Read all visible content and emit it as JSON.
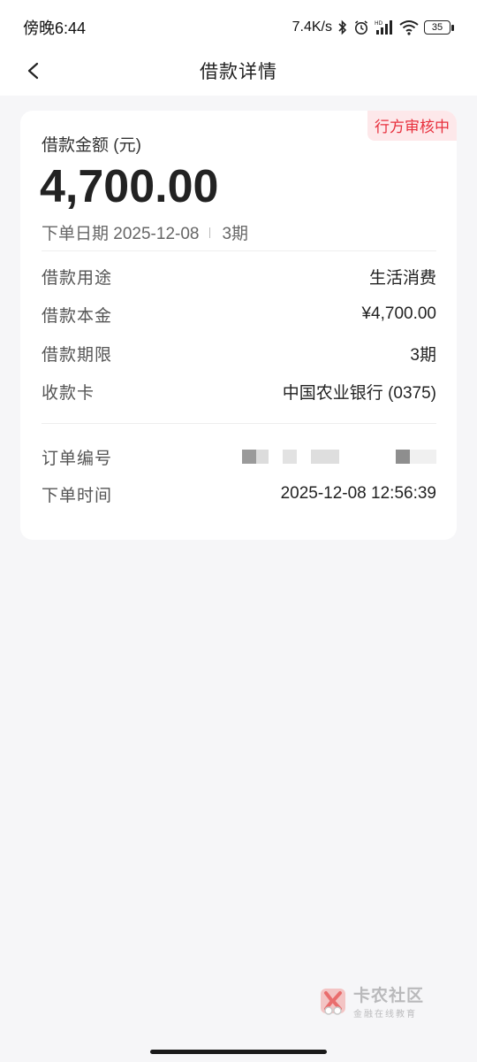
{
  "status_bar": {
    "time": "傍晚6:44",
    "network_speed": "7.4K/s",
    "battery": "35",
    "hd_label": "HD"
  },
  "nav": {
    "title": "借款详情"
  },
  "card": {
    "status_badge": "行方审核中",
    "amount_label": "借款金额 (元)",
    "amount_value": "4,700.00",
    "order_date": "下单日期 2025-12-08",
    "periods": "3期",
    "details": [
      {
        "label": "借款用途",
        "value": "生活消费"
      },
      {
        "label": "借款本金",
        "value": "¥4,700.00"
      },
      {
        "label": "借款期限",
        "value": "3期"
      },
      {
        "label": "收款卡",
        "value": "中国农业银行 (0375)"
      }
    ],
    "order_number_label": "订单编号",
    "order_time_label": "下单时间",
    "order_time_value": "2025-12-08 12:56:39"
  },
  "watermark": {
    "title": "卡农社区",
    "subtitle": "金融在线教育"
  },
  "colors": {
    "accent_red": "#e8303d",
    "badge_bg": "#fde8ea",
    "page_bg": "#f6f6f8"
  }
}
